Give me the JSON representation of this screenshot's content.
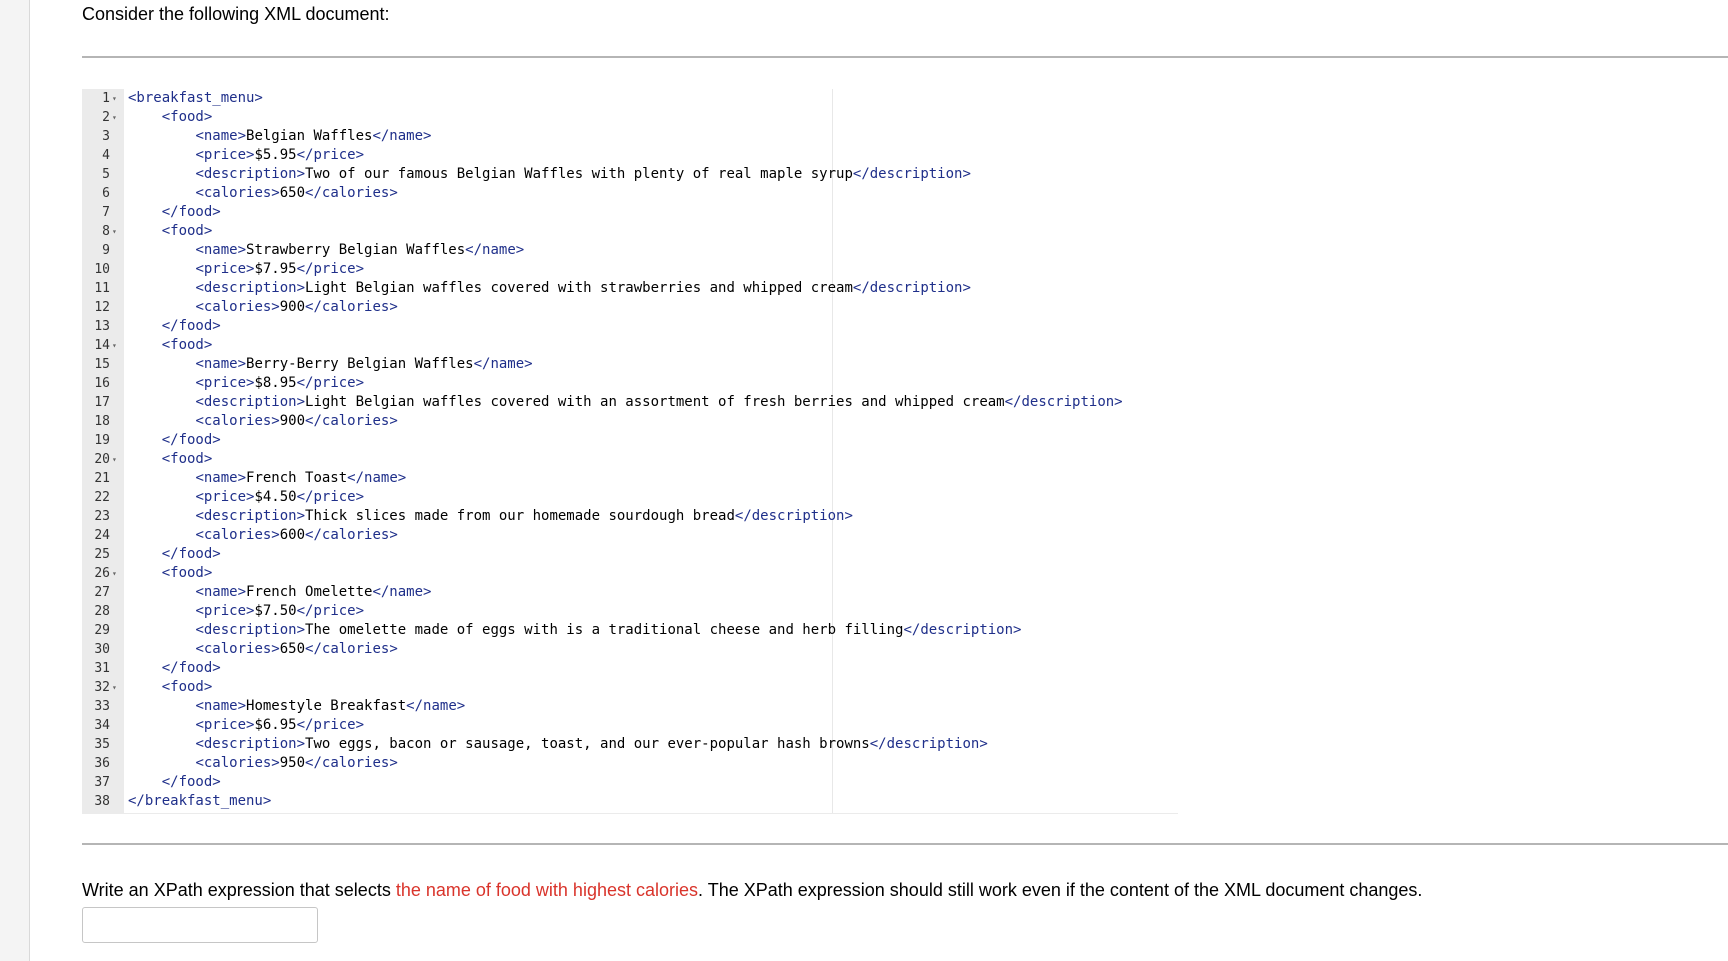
{
  "intro_text": "Consider the following XML document:",
  "editor": {
    "lines": [
      {
        "n": "1",
        "fold": true,
        "code": "<breakfast_menu>"
      },
      {
        "n": "2",
        "fold": true,
        "code": "    <food>"
      },
      {
        "n": "3",
        "fold": false,
        "code": "        <name>Belgian Waffles</name>"
      },
      {
        "n": "4",
        "fold": false,
        "code": "        <price>$5.95</price>"
      },
      {
        "n": "5",
        "fold": false,
        "code": "        <description>Two of our famous Belgian Waffles with plenty of real maple syrup</description>"
      },
      {
        "n": "6",
        "fold": false,
        "code": "        <calories>650</calories>"
      },
      {
        "n": "7",
        "fold": false,
        "code": "    </food>"
      },
      {
        "n": "8",
        "fold": true,
        "code": "    <food>"
      },
      {
        "n": "9",
        "fold": false,
        "code": "        <name>Strawberry Belgian Waffles</name>"
      },
      {
        "n": "10",
        "fold": false,
        "code": "        <price>$7.95</price>"
      },
      {
        "n": "11",
        "fold": false,
        "code": "        <description>Light Belgian waffles covered with strawberries and whipped cream</description>"
      },
      {
        "n": "12",
        "fold": false,
        "code": "        <calories>900</calories>"
      },
      {
        "n": "13",
        "fold": false,
        "code": "    </food>"
      },
      {
        "n": "14",
        "fold": true,
        "code": "    <food>"
      },
      {
        "n": "15",
        "fold": false,
        "code": "        <name>Berry-Berry Belgian Waffles</name>"
      },
      {
        "n": "16",
        "fold": false,
        "code": "        <price>$8.95</price>"
      },
      {
        "n": "17",
        "fold": false,
        "code": "        <description>Light Belgian waffles covered with an assortment of fresh berries and whipped cream</description>"
      },
      {
        "n": "18",
        "fold": false,
        "code": "        <calories>900</calories>"
      },
      {
        "n": "19",
        "fold": false,
        "code": "    </food>"
      },
      {
        "n": "20",
        "fold": true,
        "code": "    <food>"
      },
      {
        "n": "21",
        "fold": false,
        "code": "        <name>French Toast</name>"
      },
      {
        "n": "22",
        "fold": false,
        "code": "        <price>$4.50</price>"
      },
      {
        "n": "23",
        "fold": false,
        "code": "        <description>Thick slices made from our homemade sourdough bread</description>"
      },
      {
        "n": "24",
        "fold": false,
        "code": "        <calories>600</calories>"
      },
      {
        "n": "25",
        "fold": false,
        "code": "    </food>"
      },
      {
        "n": "26",
        "fold": true,
        "code": "    <food>"
      },
      {
        "n": "27",
        "fold": false,
        "code": "        <name>French Omelette</name>"
      },
      {
        "n": "28",
        "fold": false,
        "code": "        <price>$7.50</price>"
      },
      {
        "n": "29",
        "fold": false,
        "code": "        <description>The omelette made of eggs with is a traditional cheese and herb filling</description>"
      },
      {
        "n": "30",
        "fold": false,
        "code": "        <calories>650</calories>"
      },
      {
        "n": "31",
        "fold": false,
        "code": "    </food>"
      },
      {
        "n": "32",
        "fold": true,
        "code": "    <food>"
      },
      {
        "n": "33",
        "fold": false,
        "code": "        <name>Homestyle Breakfast</name>"
      },
      {
        "n": "34",
        "fold": false,
        "code": "        <price>$6.95</price>"
      },
      {
        "n": "35",
        "fold": false,
        "code": "        <description>Two eggs, bacon or sausage, toast, and our ever-popular hash browns</description>"
      },
      {
        "n": "36",
        "fold": false,
        "code": "        <calories>950</calories>"
      },
      {
        "n": "37",
        "fold": false,
        "code": "    </food>"
      },
      {
        "n": "38",
        "fold": false,
        "code": "</breakfast_menu>"
      }
    ],
    "fold_glyph": "▾",
    "tag_color": "#1f2f8a"
  },
  "question": {
    "before": "Write an XPath expression that selects ",
    "highlight": "the name of food with highest calories",
    "after": ". The XPath expression should still work even if the content of the XML document changes.",
    "highlight_color": "#d9342b"
  },
  "answer": {
    "value": "",
    "placeholder": ""
  }
}
